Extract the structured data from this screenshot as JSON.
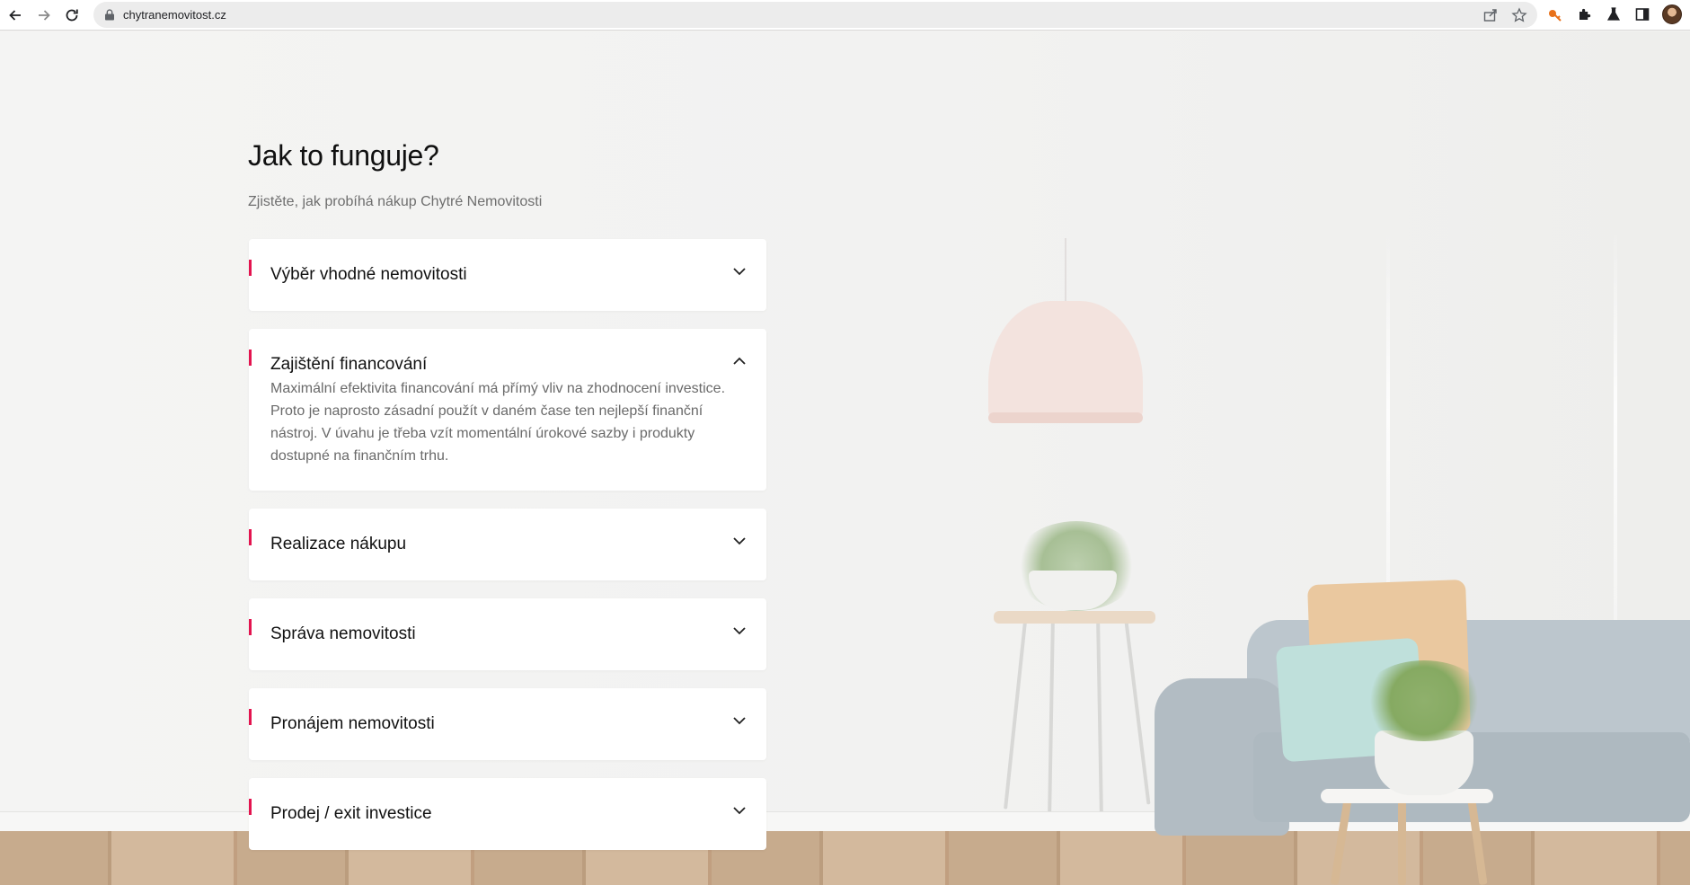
{
  "browser": {
    "url": "chytranemovitost.cz"
  },
  "page": {
    "title": "Jak to funguje?",
    "subtitle": "Zjistěte, jak probíhá nákup Chytré Nemovitosti",
    "accordion": [
      {
        "label": "Výběr vhodné nemovitosti",
        "expanded": false,
        "icon": "chevron-down-icon"
      },
      {
        "label": "Zajištění financování",
        "expanded": true,
        "icon": "chevron-up-icon",
        "body": "Maximální efektivita financování má přímý vliv na zhodnocení investice. Proto je naprosto zásadní použít v daném čase ten nejlepší finanční nástroj. V úvahu je třeba vzít momentální úrokové sazby i produkty dostupné na finančním trhu."
      },
      {
        "label": "Realizace nákupu",
        "expanded": false,
        "icon": "chevron-down-icon"
      },
      {
        "label": "Správa nemovitosti",
        "expanded": false,
        "icon": "chevron-down-icon"
      },
      {
        "label": "Pronájem nemovitosti",
        "expanded": false,
        "icon": "chevron-down-icon"
      },
      {
        "label": "Prodej / exit investice",
        "expanded": false,
        "icon": "chevron-down-icon"
      }
    ]
  },
  "colors": {
    "accent": "#e3144f",
    "background": "#f3f2f0",
    "card": "#ffffff"
  }
}
